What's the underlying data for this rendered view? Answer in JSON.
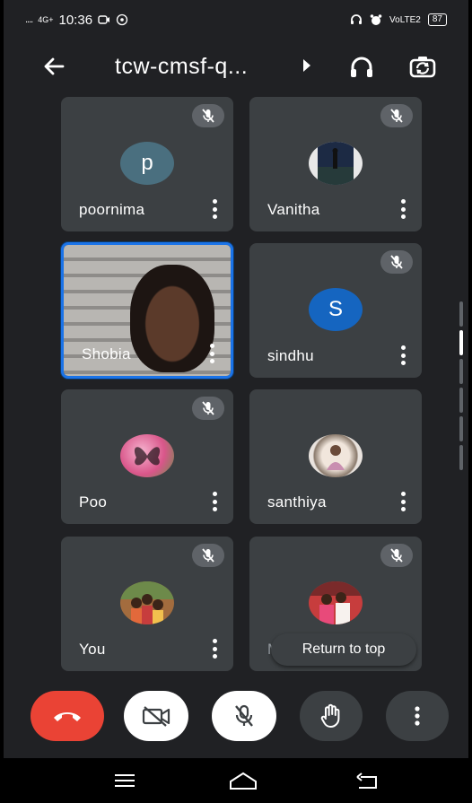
{
  "status_bar": {
    "signal": "....",
    "network": "4G+",
    "time": "10:36",
    "right_text": "VoLTE2",
    "battery": "87"
  },
  "header": {
    "back_icon": "arrow-left-icon",
    "meeting_title": "tcw-cmsf-q...",
    "audio_icon": "headphones-icon",
    "switch_camera_icon": "switch-camera-icon"
  },
  "participants": [
    {
      "name": "poornima",
      "avatar_letter": "p",
      "avatar_color": "#4a6f7f",
      "muted": true
    },
    {
      "name": "Vanitha",
      "avatar_letter": "",
      "avatar_color": "#e8e8e8",
      "muted": true
    },
    {
      "name": "Shobia",
      "avatar_letter": "",
      "avatar_color": "",
      "muted": false,
      "video": true,
      "active_speaker": true
    },
    {
      "name": "sindhu",
      "avatar_letter": "S",
      "avatar_color": "#1565c0",
      "muted": true
    },
    {
      "name": "Poo",
      "avatar_letter": "",
      "avatar_color": "#d9568a",
      "muted": true
    },
    {
      "name": "santhiya",
      "avatar_letter": "",
      "avatar_color": "#c9b6a4",
      "muted": false
    },
    {
      "name": "You",
      "avatar_letter": "",
      "avatar_color": "#a36c3e",
      "muted": true
    },
    {
      "name": "M",
      "avatar_letter": "",
      "avatar_color": "#c73d3d",
      "muted": true
    }
  ],
  "return_to_top": "Return to top",
  "controls": {
    "end_call_icon": "end-call-icon",
    "camera_off_icon": "camera-off-icon",
    "mic_off_icon": "mic-off-icon",
    "raise_hand_icon": "raise-hand-icon",
    "more_icon": "more-vert-icon"
  },
  "navigation": {
    "menu_icon": "menu-icon",
    "home_icon": "home-icon",
    "back_icon": "back-icon"
  },
  "colors": {
    "background": "#202124",
    "tile": "#3c4043",
    "end_call": "#ea4335",
    "active_border": "#1a73e8"
  }
}
